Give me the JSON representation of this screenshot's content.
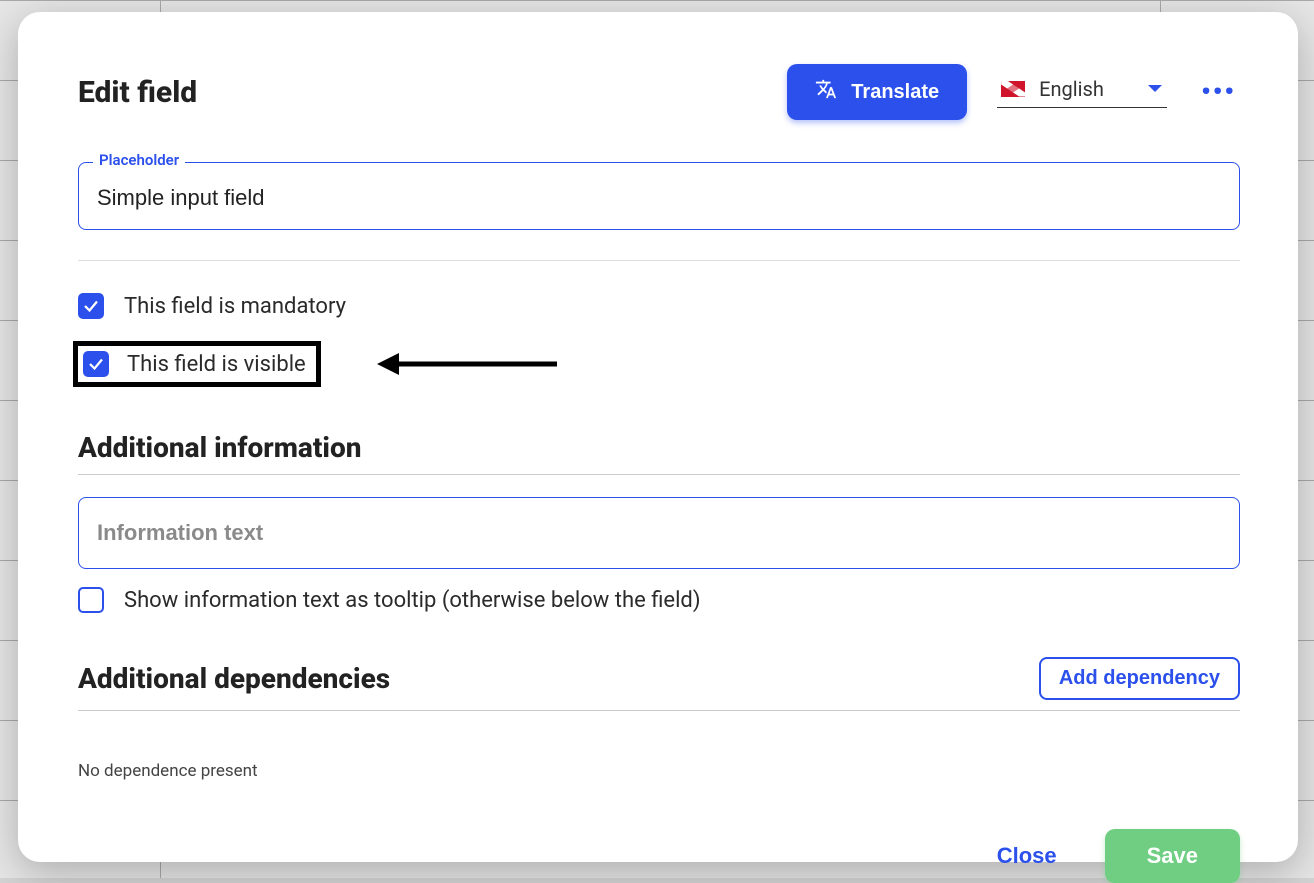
{
  "header": {
    "title": "Edit field",
    "translate_label": "Translate",
    "language": "English"
  },
  "placeholder_field": {
    "label": "Placeholder",
    "value": "Simple input field"
  },
  "checks": {
    "mandatory_label": "This field is mandatory",
    "visible_label": "This field is visible"
  },
  "additional_info": {
    "heading": "Additional information",
    "placeholder": "Information text",
    "tooltip_label": "Show information text as tooltip (otherwise below the field)"
  },
  "dependencies": {
    "heading": "Additional dependencies",
    "add_label": "Add dependency",
    "empty_text": "No dependence present"
  },
  "footer": {
    "close_label": "Close",
    "save_label": "Save"
  }
}
